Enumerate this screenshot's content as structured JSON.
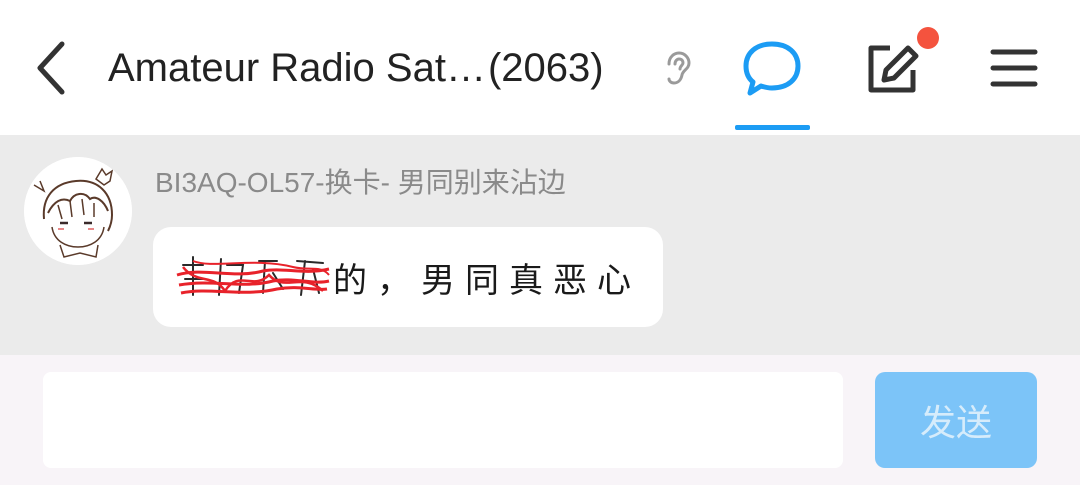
{
  "header": {
    "title": "Amateur Radio Sat…",
    "member_count": "(2063)",
    "icons": {
      "back": "back-chevron-icon",
      "voice": "ear-icon",
      "chat": "chat-bubble-icon",
      "edit": "edit-icon",
      "menu": "hamburger-menu-icon"
    },
    "active_tab_color": "#1c9cf4",
    "notification_dot_color": "#f4533e"
  },
  "messages": [
    {
      "sender": "BI3AQ-OL57-换卡- 男同别来沾边",
      "avatar": "anime-girl-avatar",
      "text": "的，男同真恶心",
      "has_scribbled_out_text": true,
      "scribble_color": "#e8222a"
    }
  ],
  "composer": {
    "input_value": "",
    "send_label": "发送",
    "send_color": "#7cc4f8"
  }
}
